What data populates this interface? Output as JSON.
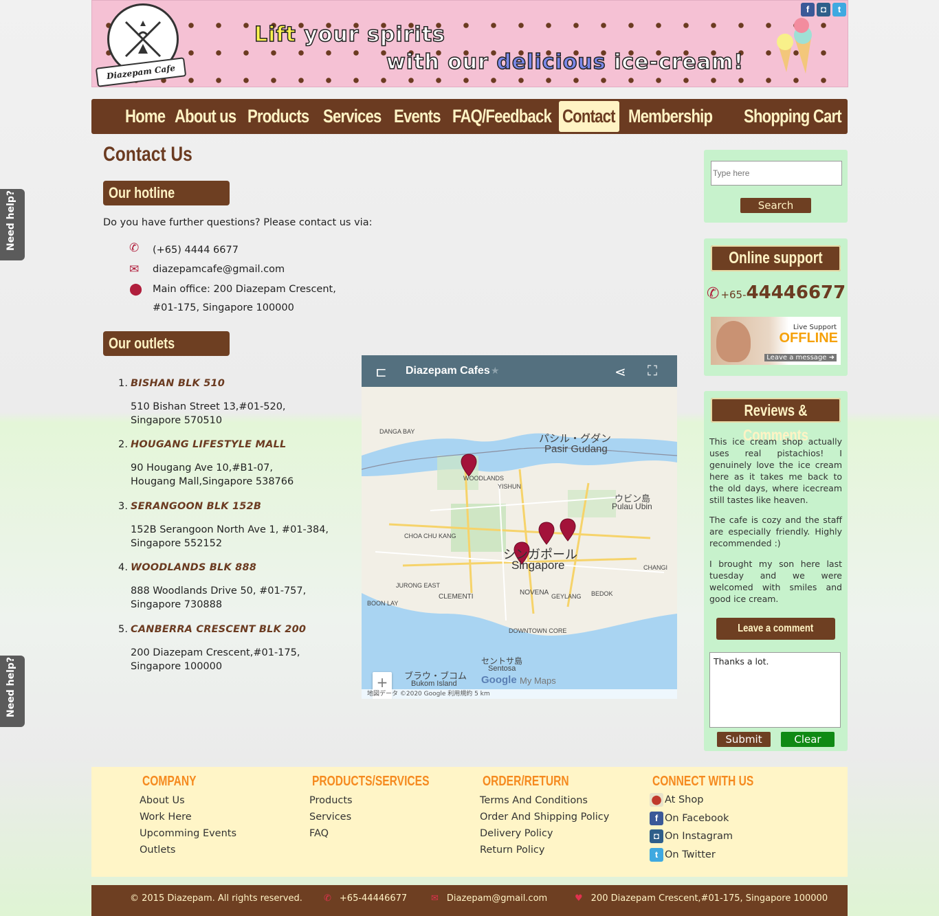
{
  "banner": {
    "logo_text": "Diazepam Cafe",
    "slogan_line1_a": "Lift",
    "slogan_line1_b": "your spirits",
    "slogan_line2_a": "with our",
    "slogan_line2_b": "delicious",
    "slogan_line2_c": "ice-cream!"
  },
  "nav": {
    "items": [
      "Home",
      "About us",
      "Products",
      "Services",
      "Events",
      "FAQ/Feedback",
      "Contact",
      "Membership",
      "Shopping Cart"
    ],
    "active": "Contact"
  },
  "main": {
    "page_title": "Contact Us",
    "hotline_heading": "Our hotline",
    "intro": "Do you have further questions? Please contact us via:",
    "phone": "(+65) 4444 6677",
    "email": "diazepamcafe@gmail.com",
    "address_line1": "Main office: 200 Diazepam Crescent,",
    "address_line2": "#01-175, Singapore 100000",
    "outlets_heading": "Our outlets",
    "outlets": [
      {
        "num": "1.",
        "name": "BISHAN BLK 510",
        "addr1": "510 Bishan Street 13,#01-520,",
        "addr2": "Singapore 570510"
      },
      {
        "num": "2.",
        "name": "HOUGANG LIFESTYLE MALL",
        "addr1": "90 Hougang Ave 10,#B1-07,",
        "addr2": "Hougang Mall,Singapore 538766"
      },
      {
        "num": "3.",
        "name": "SERANGOON BLK 152B",
        "addr1": "152B Serangoon North Ave 1, #01-384,",
        "addr2": "Singapore 552152"
      },
      {
        "num": "4.",
        "name": "WOODLANDS BLK 888",
        "addr1": "888 Woodlands Drive 50, #01-757,",
        "addr2": "Singapore 730888"
      },
      {
        "num": "5.",
        "name": "CANBERRA CRESCENT BLK 200",
        "addr1": "200 Diazepam Crescent,#01-175,",
        "addr2": "Singapore 100000"
      }
    ]
  },
  "map": {
    "title": "Diazepam Cafes",
    "labels": {
      "pasir_jp": "パシル・グダン",
      "pasir": "Pasir Gudang",
      "ubin_jp": "ウビン島",
      "ubin": "Pulau Ubin",
      "sg_jp": "シンガポール",
      "sg": "Singapore",
      "woodlands": "WOODLANDS",
      "yishun": "YISHUN",
      "choa": "CHOA CHU KANG",
      "jurong": "JURONG EAST",
      "clementi": "CLEMENTI",
      "boonlay": "BOON LAY",
      "novena": "NOVENA",
      "geylang": "GEYLANG",
      "bedok": "BEDOK",
      "changi": "CHANGI",
      "downtown": "DOWNTOWN CORE",
      "sentosa_jp": "セントサ島",
      "sentosa": "Sentosa",
      "bukom_jp": "ブラウ・ブコム",
      "bukom": "Bukom Island",
      "danga": "DANGA BAY",
      "mymaps": "My Maps",
      "google": "Google"
    },
    "footer": "地図データ ©2020 Google   利用規約   5 km"
  },
  "sidebar": {
    "search_placeholder": "Type here",
    "search_button": "Search",
    "support_title": "Online support",
    "support_prefix": "+65-",
    "support_number": "44446677",
    "live_small": "Live Support",
    "live_status": "OFFLINE",
    "live_leave": "Leave a message ➜",
    "reviews_title": "Reviews & Comments",
    "reviews": [
      "This ice cream shop actually uses real pistachios! I genuinely love the ice cream here as it takes me back to the old days, where icecream still tastes like heaven.",
      "The cafe is cozy and the staff are especially friendly. Highly recommended :)",
      "I brought my son here last tuesday and we were welcomed with smiles and good ice cream."
    ],
    "leave_comment": "Leave a comment",
    "comment_value": "Thanks a lot.",
    "submit": "Submit",
    "clear": "Clear"
  },
  "need_help": "Need help?",
  "footer": {
    "company_title": "COMPANY",
    "company_links": [
      "About Us",
      "Work Here",
      "Upcomming Events",
      "Outlets"
    ],
    "products_title": "PRODUCTS/SERVICES",
    "products_links": [
      "Products",
      "Services",
      "FAQ"
    ],
    "order_title": "ORDER/RETURN",
    "order_links": [
      "Terms And Conditions",
      "Order And Shipping Policy",
      "Delivery Policy",
      "Return Policy"
    ],
    "connect_title": "CONNECT WITH US",
    "connect_links": [
      "At Shop",
      "On Facebook",
      "On Instagram",
      "On Twitter"
    ],
    "copyright": "© 2015 Diazepam. All rights reserved.",
    "phone": "+65-44446677",
    "email": "Diazepam@gmail.com",
    "address": "200 Diazepam Crescent,#01-175, Singapore 100000"
  },
  "colors": {
    "brown": "#6b3b21",
    "cream": "#fff3c4",
    "sidebar_green": "#c7f2cc",
    "footer_orange": "#f58a1f",
    "clear_green": "#0f8a14",
    "pin_red": "#b01e3c"
  }
}
